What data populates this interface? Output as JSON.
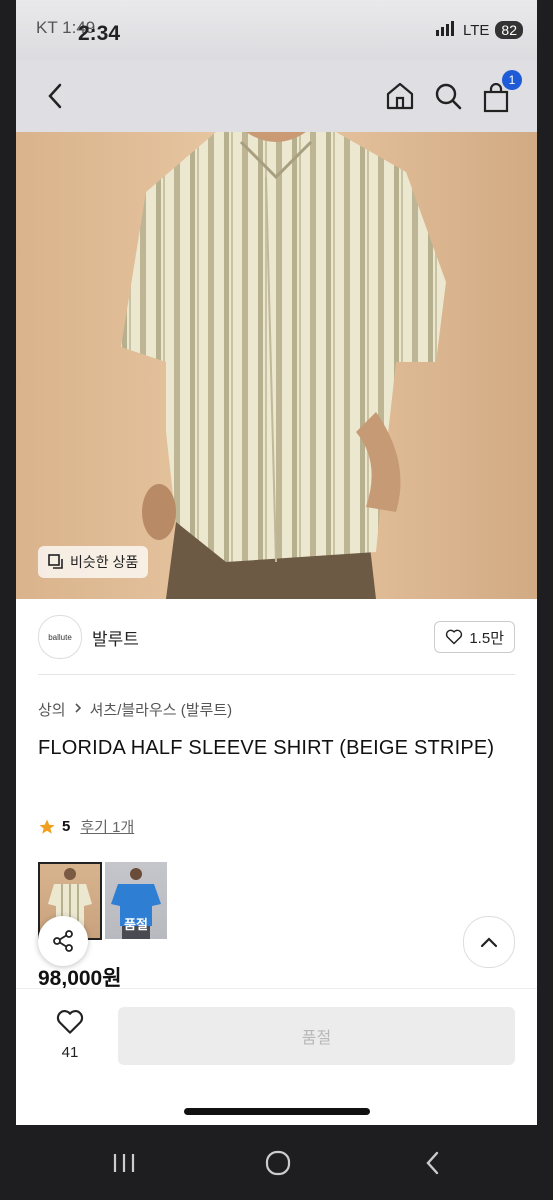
{
  "status_bar": {
    "carrier": "KT 1:49",
    "time": "2:34",
    "network": "LTE",
    "battery": "82"
  },
  "header": {
    "cart_count": "1"
  },
  "hero": {
    "similar_label": "비슷한 상품"
  },
  "brand": {
    "logo_text": "ballute",
    "name": "발루트",
    "likes": "1.5만"
  },
  "breadcrumb": {
    "category": "상의",
    "subcategory": "셔츠/블라우스 (발루트)"
  },
  "product": {
    "title": "FLORIDA HALF SLEEVE SHIRT (BEIGE STRIPE)",
    "rating": "5",
    "review_label": "후기 1개",
    "price": "98,000원"
  },
  "thumbnails": [
    {
      "label": ""
    },
    {
      "label": "품절"
    }
  ],
  "bottom_bar": {
    "wish_count": "41",
    "buy_label": "품절"
  },
  "colors": {
    "accent_badge": "#1f5bd6",
    "star": "#f0a020"
  }
}
